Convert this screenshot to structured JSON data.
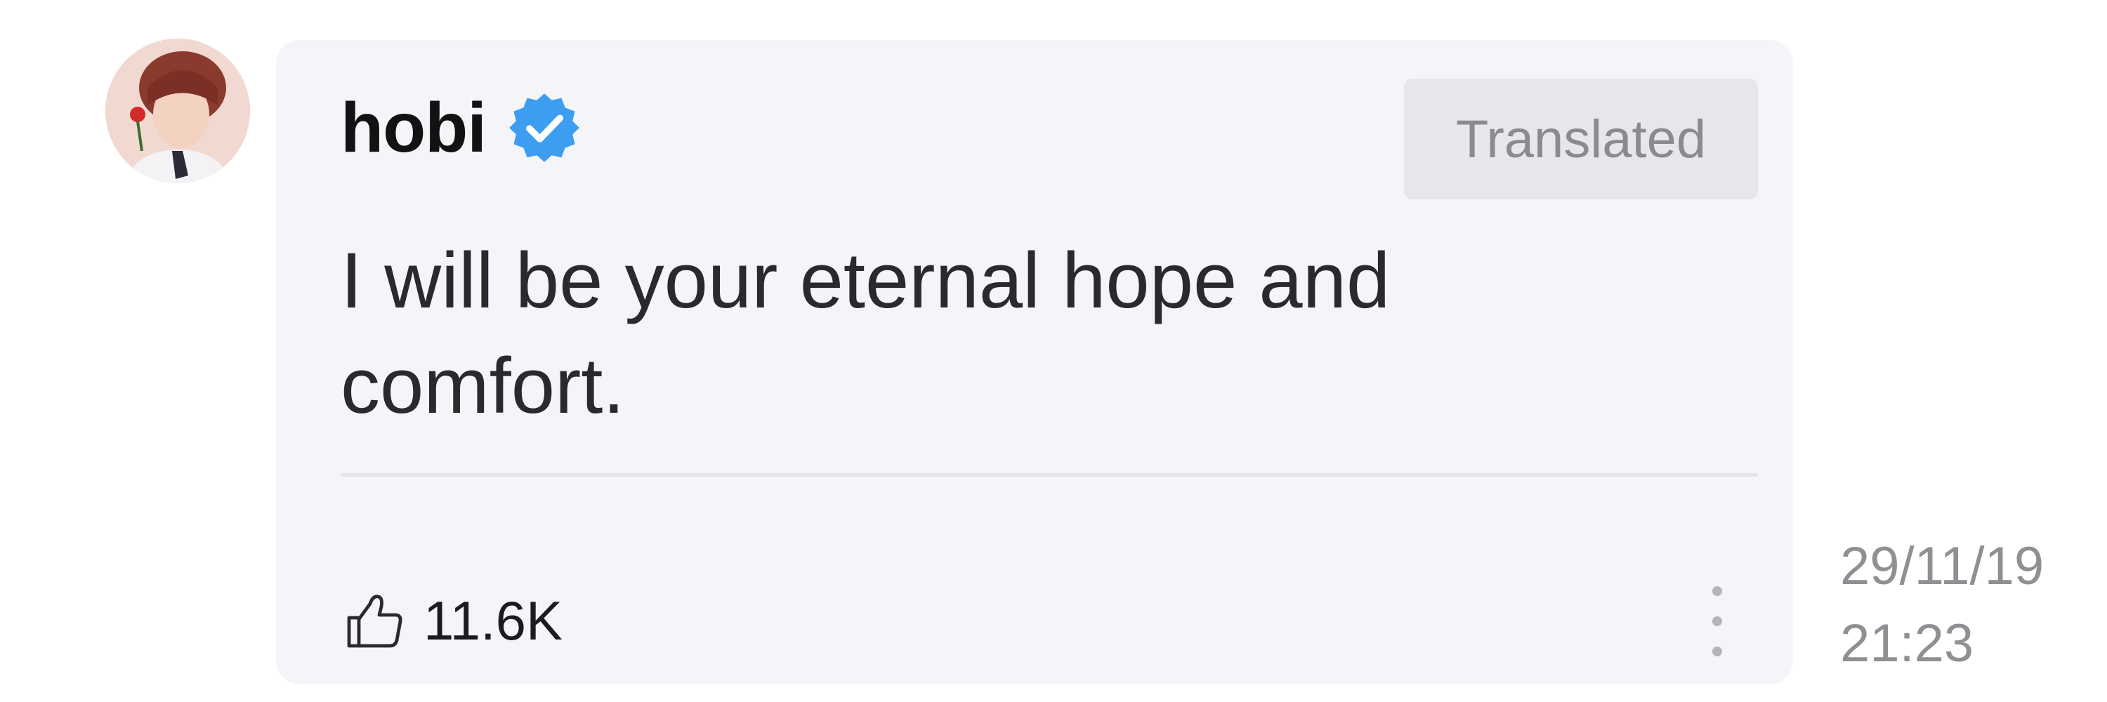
{
  "post": {
    "author": {
      "name": "hobi",
      "verified_icon": "verified-badge-icon",
      "avatar_icon": "profile-avatar"
    },
    "badge_label": "Translated",
    "message": "I will be your eternal hope and comfort.",
    "likes": {
      "icon": "thumbs-up-icon",
      "count": "11.6K"
    },
    "more_icon": "vertical-ellipsis-icon",
    "date": "29/11/19",
    "time": "21:23"
  },
  "colors": {
    "bubble": "#f4f5f9",
    "badge_bg": "#e6e7ea",
    "verified": "#3d9df0",
    "text_primary": "#121212",
    "text_muted": "#8f9094"
  }
}
